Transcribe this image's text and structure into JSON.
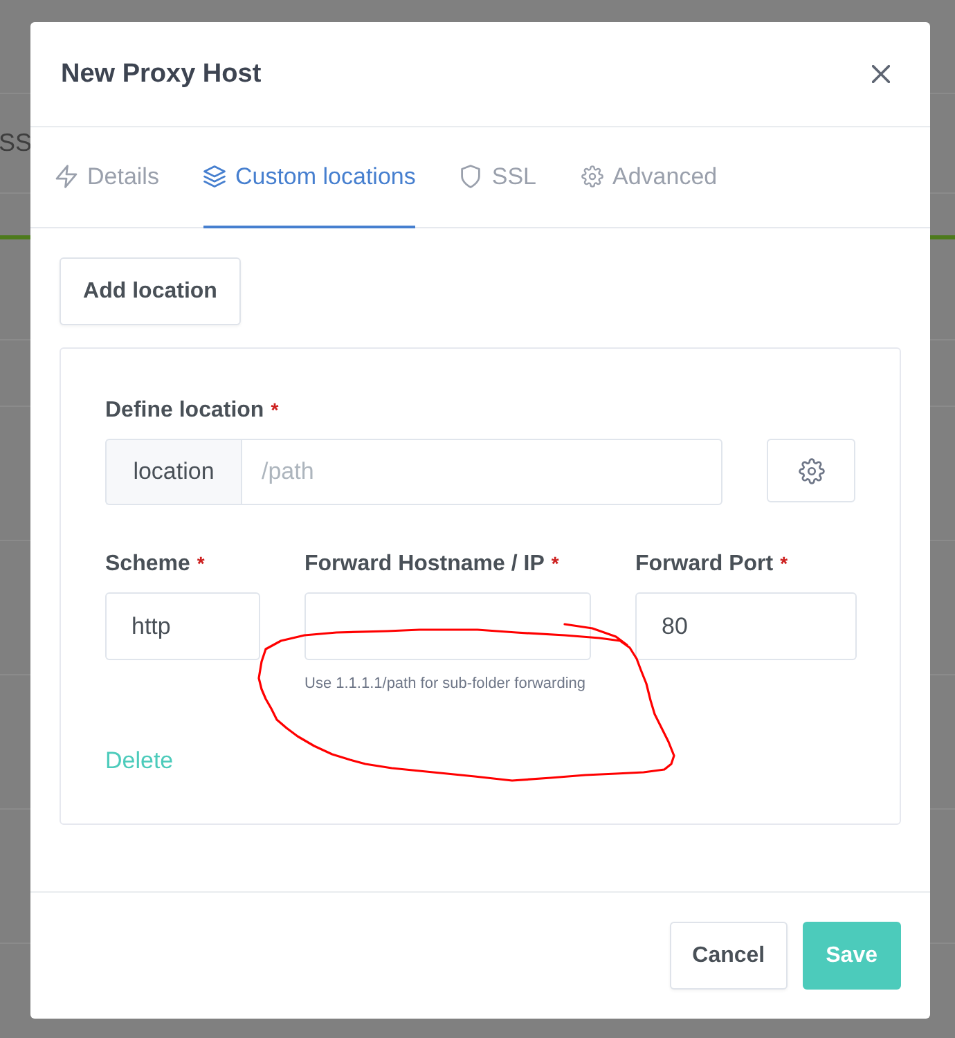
{
  "background_page": {
    "cut_text": "SS"
  },
  "dialog": {
    "title": "New Proxy Host"
  },
  "tabs": [
    {
      "label": "Details",
      "selected": false
    },
    {
      "label": "Custom locations",
      "selected": true
    },
    {
      "label": "SSL",
      "selected": false
    },
    {
      "label": "Advanced",
      "selected": false
    }
  ],
  "add_location_button": "Add location",
  "location": {
    "label": "Define location",
    "required_mark": "*",
    "prefix": "location",
    "placeholder": "/path"
  },
  "fields": [
    {
      "label": "Scheme",
      "required_mark": "*",
      "value": "http"
    },
    {
      "label": "Forward Hostname / IP",
      "required_mark": "*",
      "hint": "Use 1.1.1.1/path for sub-folder forwarding"
    },
    {
      "label": "Forward Port",
      "required_mark": "*",
      "value": "80"
    }
  ],
  "delete_link": "Delete",
  "footer_buttons": [
    {
      "label": "Cancel",
      "kind": "secondary"
    },
    {
      "label": "Save",
      "kind": "primary"
    }
  ],
  "annotation": {
    "kind": "freehand-loop"
  }
}
